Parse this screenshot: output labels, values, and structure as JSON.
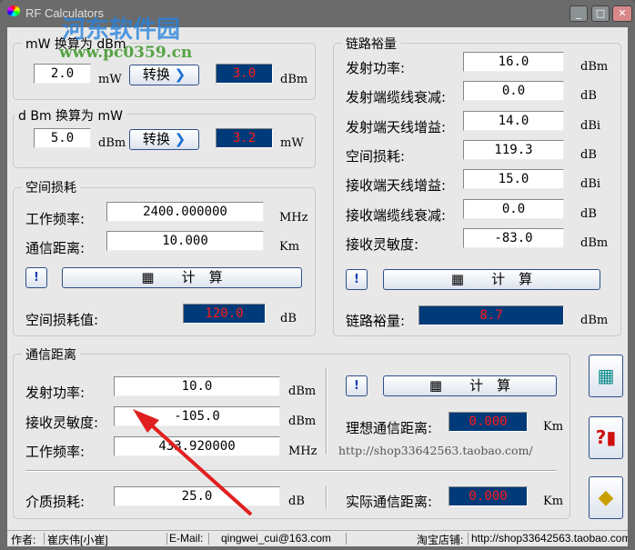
{
  "window": {
    "title": "RF Calculators",
    "minimize": "_",
    "maximize": "□",
    "close": "✕"
  },
  "watermark": {
    "line1": "河东软件园",
    "line2": "www.pc0359.cn"
  },
  "mw_to_dbm": {
    "title": "mW 换算为 dBm",
    "input": "2.0",
    "input_unit": "mW",
    "button": "转换",
    "result": "3.0",
    "result_unit": "dBm"
  },
  "dbm_to_mw": {
    "title": "d Bm 换算为 mW",
    "input": "5.0",
    "input_unit": "dBm",
    "button": "转换",
    "result": "3.2",
    "result_unit": "mW"
  },
  "space_loss": {
    "title": "空间损耗",
    "freq_label": "工作频率:",
    "freq": "2400.000000",
    "freq_unit": "MHz",
    "dist_label": "通信距离:",
    "dist": "10.000",
    "dist_unit": "Km",
    "calc": "计　算",
    "result_label": "空间损耗值:",
    "result": "120.0",
    "result_unit": "dB"
  },
  "link_margin": {
    "title": "链路裕量",
    "rows": [
      {
        "label": "发射功率:",
        "value": "16.0",
        "unit": "dBm"
      },
      {
        "label": "发射端缆线衰减:",
        "value": "0.0",
        "unit": "dB"
      },
      {
        "label": "发射端天线增益:",
        "value": "14.0",
        "unit": "dBi"
      },
      {
        "label": "空间损耗:",
        "value": "119.3",
        "unit": "dB"
      },
      {
        "label": "接收端天线增益:",
        "value": "15.0",
        "unit": "dBi"
      },
      {
        "label": "接收端缆线衰减:",
        "value": "0.0",
        "unit": "dB"
      },
      {
        "label": "接收灵敏度:",
        "value": "-83.0",
        "unit": "dBm"
      }
    ],
    "calc": "计　算",
    "result_label": "链路裕量:",
    "result": "8.7",
    "result_unit": "dBm"
  },
  "comm_dist": {
    "title": "通信距离",
    "tx_label": "发射功率:",
    "tx": "10.0",
    "tx_unit": "dBm",
    "rx_label": "接收灵敏度:",
    "rx": "-105.0",
    "rx_unit": "dBm",
    "freq_label": "工作频率:",
    "freq": "433.920000",
    "freq_unit": "MHz",
    "medium_label": "介质损耗:",
    "medium": "25.0",
    "medium_unit": "dB",
    "calc": "计　算",
    "ideal_label": "理想通信距离:",
    "ideal": "0.000",
    "ideal_unit": "Km",
    "url": "http://shop33642563.taobao.com/",
    "actual_label": "实际通信距离:",
    "actual": "0.000",
    "actual_unit": "Km"
  },
  "status": {
    "author_label": "作者:",
    "author": "崔庆伟[小崔]",
    "email_label": "E-Mail:",
    "email": "qingwei_cui@163.com",
    "shop_label": "淘宝店铺:",
    "shop": "http://shop33642563.taobao.com"
  },
  "colors": {
    "display_bg": "#003a78",
    "display_text": "#ff1a1a"
  }
}
